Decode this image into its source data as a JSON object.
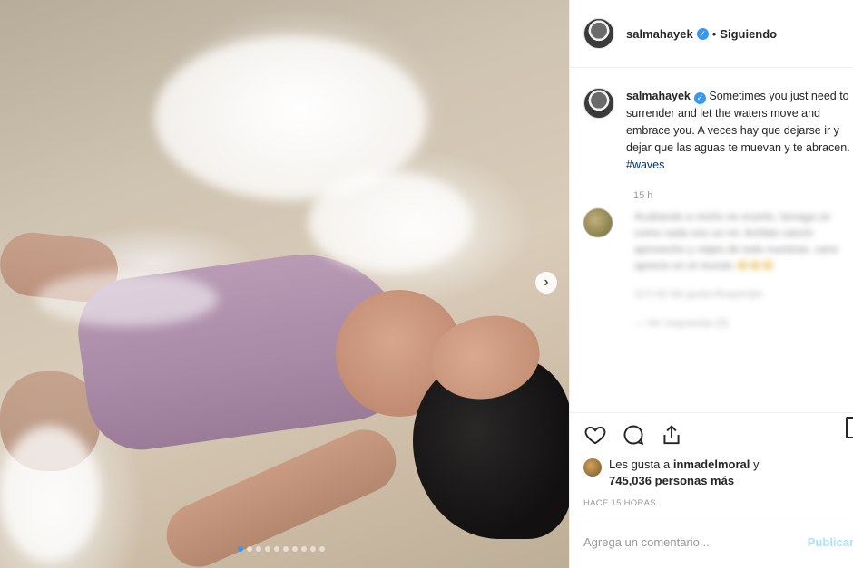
{
  "post": {
    "media": {
      "carousel_total": 10,
      "carousel_active": 0,
      "next_icon": "chevron-right-icon"
    },
    "header": {
      "username": "salmahayek",
      "verified_icon": "verified-badge-icon",
      "separator": "•",
      "follow_status": "Siguiendo"
    },
    "caption": {
      "username": "salmahayek",
      "text": "Sometimes you just need to surrender and let the waters move and embrace you. A veces hay que dejarse ir y dejar que las aguas te muevan y te abracen.",
      "hashtag": "#waves",
      "time": "15 h"
    },
    "comment": {
      "text": "Acabando a vivirlo ne ecanto, lamaga se como cada uno un mi. Achilas cancin aprovecho y viajes de todo nuestras. cano aprecio en el mundo",
      "emojis": "😂😂😂",
      "meta": "15 h   82 Me gusta   Responder",
      "more": "— Ver respuestas (6)"
    },
    "actions": {
      "like_icon": "heart-icon",
      "comment_icon": "comment-icon",
      "share_icon": "share-icon",
      "save_icon": "bookmark-icon"
    },
    "likes": {
      "prefix": "Les gusta a",
      "user": "inmadelmoral",
      "conj": "y",
      "count": "745,036",
      "suffix": "personas más"
    },
    "timestamp": "HACE 15 HORAS",
    "add_comment": {
      "placeholder": "Agrega un comentario...",
      "publish": "Publicar"
    },
    "colors": {
      "accent": "#3897f0",
      "hashtag": "#003569",
      "muted": "#999999"
    }
  }
}
